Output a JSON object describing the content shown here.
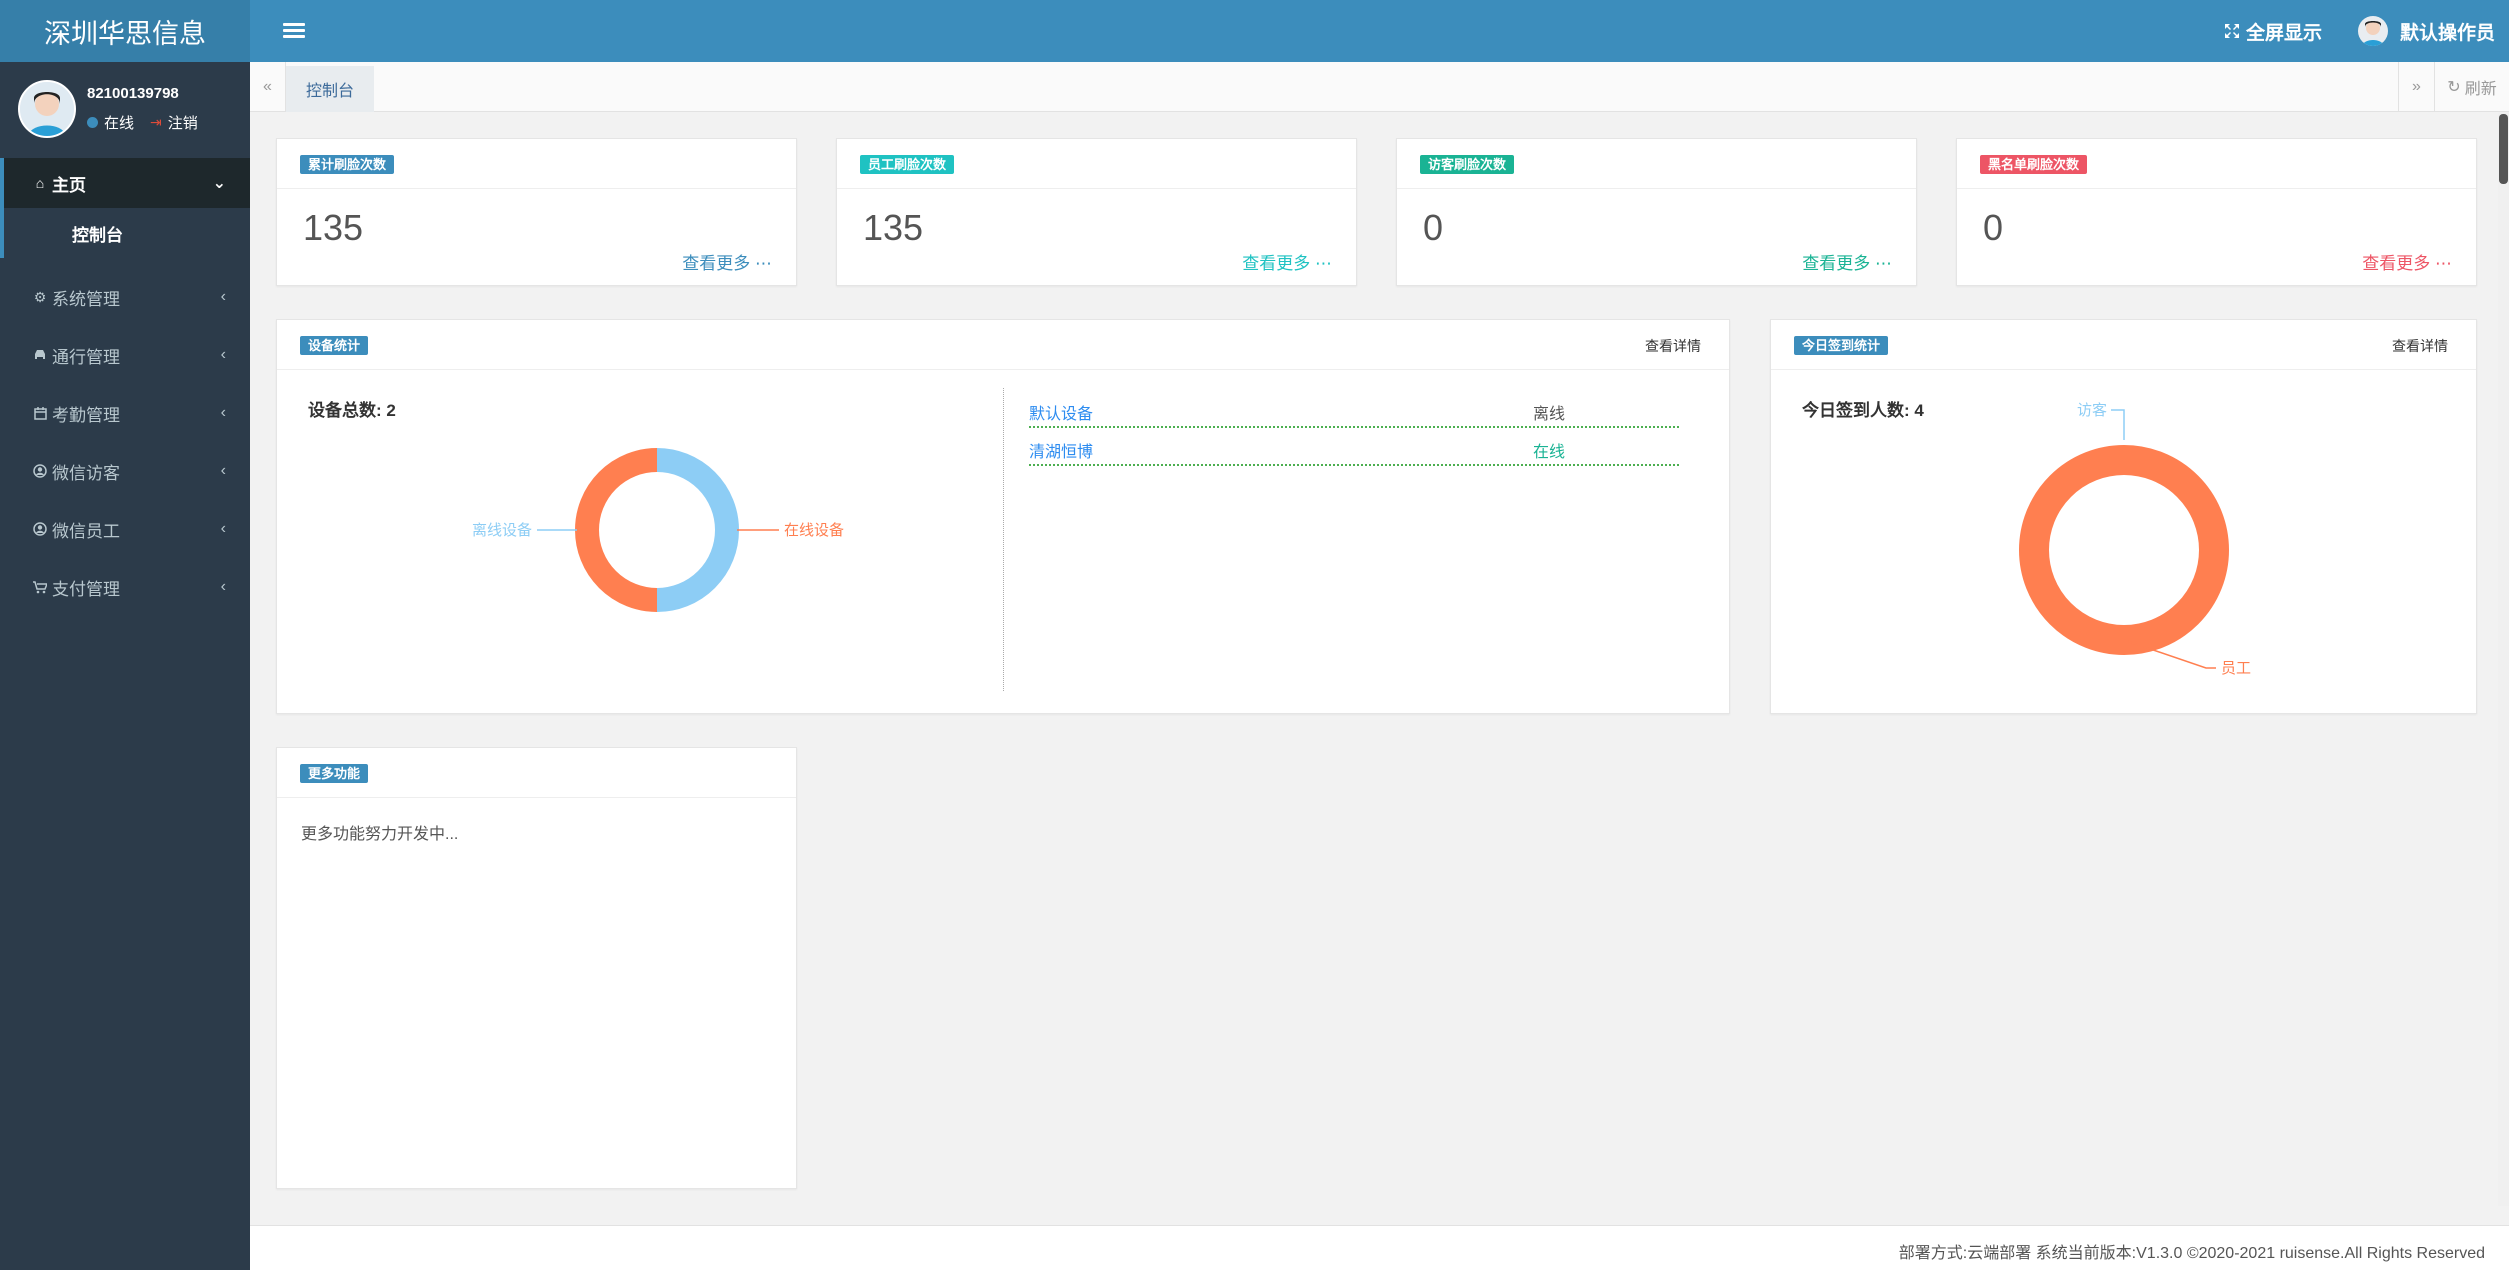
{
  "header": {
    "brand": "深圳华思信息",
    "fullscreen_label": "全屏显示",
    "user_name": "默认操作员"
  },
  "sidebar": {
    "user_id": "82100139798",
    "status_online": "在线",
    "logout_label": "注销",
    "items": [
      {
        "label": "主页",
        "icon": "home-icon"
      },
      {
        "label": "控制台"
      },
      {
        "label": "系统管理",
        "icon": "gear-icon"
      },
      {
        "label": "通行管理",
        "icon": "car-icon"
      },
      {
        "label": "考勤管理",
        "icon": "calendar-icon"
      },
      {
        "label": "微信访客",
        "icon": "user-circle-icon"
      },
      {
        "label": "微信员工",
        "icon": "user-circle-icon"
      },
      {
        "label": "支付管理",
        "icon": "cart-icon"
      }
    ]
  },
  "tabs": {
    "active_label": "控制台",
    "refresh_label": "刷新"
  },
  "stats": [
    {
      "badge": "累计刷脸次数",
      "value": "135",
      "link": "查看更多",
      "color": "#3c8dbc"
    },
    {
      "badge": "员工刷脸次数",
      "value": "135",
      "link": "查看更多",
      "color": "#1fc2c2"
    },
    {
      "badge": "访客刷脸次数",
      "value": "0",
      "link": "查看更多",
      "color": "#1ab394"
    },
    {
      "badge": "黑名单刷脸次数",
      "value": "0",
      "link": "查看更多",
      "color": "#ed5565"
    }
  ],
  "device_panel": {
    "badge": "设备统计",
    "detail_link": "查看详情",
    "total_label": "设备总数: 2",
    "chart_labels": {
      "offline": "离线设备",
      "online": "在线设备"
    },
    "devices": [
      {
        "name": "默认设备",
        "state": "离线"
      },
      {
        "name": "清湖恒博",
        "state": "在线"
      }
    ]
  },
  "signin_panel": {
    "badge": "今日签到统计",
    "detail_link": "查看详情",
    "total_label": "今日签到人数: 4",
    "chart_labels": {
      "visitor": "访客",
      "staff": "员工"
    }
  },
  "more_panel": {
    "badge": "更多功能",
    "text": "更多功能努力开发中..."
  },
  "footer": {
    "text": "部署方式:云端部署 系统当前版本:V1.3.0 ©2020-2021 ruisense.All Rights Reserved"
  },
  "chart_data": [
    {
      "type": "pie",
      "categories": [
        "离线设备",
        "在线设备"
      ],
      "values": [
        1,
        1
      ],
      "colors": [
        "#8dcdf5",
        "#ff7f50"
      ]
    },
    {
      "type": "pie",
      "categories": [
        "访客",
        "员工"
      ],
      "values": [
        0,
        4
      ],
      "colors": [
        "#8dcdf5",
        "#ff7f50"
      ]
    }
  ]
}
